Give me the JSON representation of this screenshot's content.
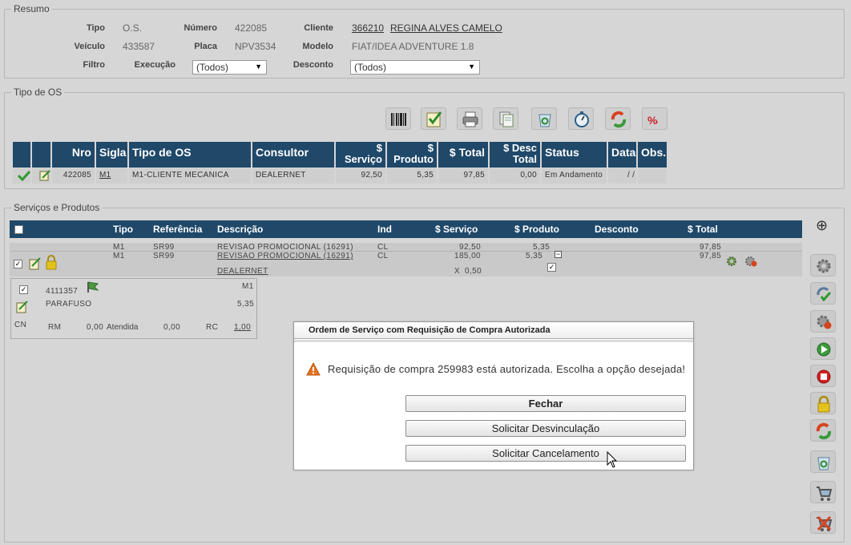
{
  "resumo": {
    "legend": "Resumo",
    "tipo_label": "Tipo",
    "tipo_value": "O.S.",
    "numero_label": "Número",
    "numero_value": "422085",
    "cliente_label": "Cliente",
    "cliente_code": "366210",
    "cliente_name": "REGINA ALVES CAMELO",
    "veiculo_label": "Veículo",
    "veiculo_value": "433587",
    "placa_label": "Placa",
    "placa_value": "NPV3534",
    "modelo_label": "Modelo",
    "modelo_value": "FIAT/IDEA ADVENTURE 1.8",
    "filtro_label": "Filtro",
    "execucao_label": "Execução",
    "execucao_value": "(Todos)",
    "desconto_label": "Desconto",
    "desconto_value": "(Todos)"
  },
  "tipo_os": {
    "legend": "Tipo de OS",
    "toolbar": [
      "barcode-icon",
      "checklist-icon",
      "printer-icon",
      "documents-icon",
      "recycle-bin-icon",
      "stopwatch-icon",
      "refresh-icon",
      "discount-icon"
    ],
    "headers": {
      "nro": "Nro",
      "sigla": "Sigla",
      "tipo": "Tipo de OS",
      "consultor": "Consultor",
      "servico_1": "$",
      "servico_2": "Serviço",
      "produto_1": "$",
      "produto_2": "Produto",
      "total": "$ Total",
      "desc_1": "$ Desc",
      "desc_2": "Total",
      "status": "Status",
      "data": "Data",
      "obs": "Obs."
    },
    "row": {
      "nro": "422085",
      "sigla": "M1",
      "tipo": "M1-CLIENTE MECANICA",
      "consultor": "DEALERNET",
      "servico": "92,50",
      "produto": "5,35",
      "total": "97,85",
      "desc_total": "0,00",
      "status": "Em Andamento",
      "data": "/ /",
      "obs": ""
    }
  },
  "servicos": {
    "legend": "Serviços e Produtos",
    "headers": {
      "tipo": "Tipo",
      "referencia": "Referência",
      "descricao": "Descrição",
      "ind": "Ind",
      "servico": "$ Serviço",
      "produto": "$ Produto",
      "desconto": "Desconto",
      "total": "$ Total"
    },
    "rows": [
      {
        "tipo": "M1",
        "ref": "SR99",
        "desc": "REVISAO PROMOCIONAL (16291)",
        "ind": "CL",
        "servico": "92,50",
        "produto": "5,35",
        "total": "97,85"
      },
      {
        "tipo": "M1",
        "ref": "SR99",
        "desc": "REVISAO PROMOCIONAL (16291)",
        "ind": "CL",
        "servico": "185,00",
        "produto": "5,35",
        "total": "97,85"
      }
    ],
    "consultor": "DEALERNET",
    "multiplier_label": "X",
    "multiplier_value": "0,50",
    "collapse_symbol": "−",
    "check_mark": "✓",
    "sub": {
      "code": "4111357",
      "type": "M1",
      "name": "PARAFUSO",
      "value": "5,35",
      "cn": "CN",
      "rm_label": "RM",
      "rm_value": "0,00",
      "atendida_label": "Atendida",
      "atendida_value": "0,00",
      "rc_label": "RC",
      "rc_value": "1,00"
    },
    "add_symbol": "⊕"
  },
  "dialog": {
    "title": "Ordem de Serviço com Requisição de Compra Autorizada",
    "message": "Requisição de compra 259983 está autorizada. Escolha a opção desejada!",
    "btn_close": "Fechar",
    "btn_unlink": "Solicitar Desvinculação",
    "btn_cancel": "Solicitar Cancelamento"
  },
  "colors": {
    "header_bg": "#1f4869",
    "page_bg": "#d6d6d6",
    "warning": "#e8731f"
  }
}
